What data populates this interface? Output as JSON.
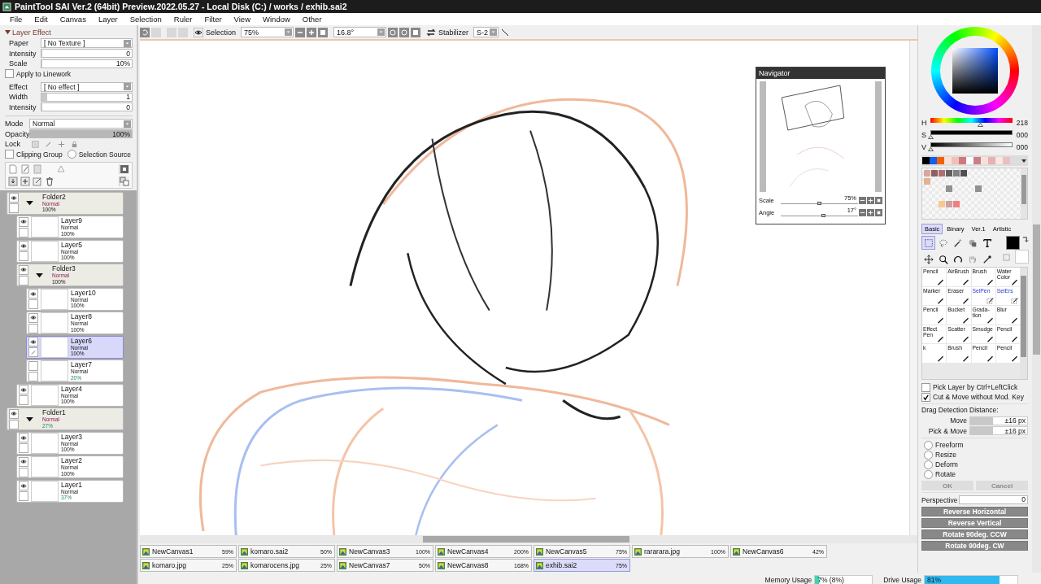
{
  "window": {
    "title": "PaintTool SAI Ver.2 (64bit) Preview.2022.05.27 - Local Disk (C:) / works / exhib.sai2"
  },
  "menu": [
    "File",
    "Edit",
    "Canvas",
    "Layer",
    "Selection",
    "Ruler",
    "Filter",
    "View",
    "Window",
    "Other"
  ],
  "layer_effect": {
    "title": "Layer Effect",
    "expanded": true,
    "paper": {
      "label": "Paper",
      "value": "[ No Texture ]"
    },
    "paper_intensity": {
      "label": "Intensity",
      "value": "0",
      "level": 0
    },
    "scale": {
      "label": "Scale",
      "value": "10%",
      "level": 0.01
    },
    "apply_to_linework": {
      "label": "Apply to Linework",
      "checked": false
    },
    "effect": {
      "label": "Effect",
      "value": "[ No effect ]"
    },
    "width": {
      "label": "Width",
      "value": "1",
      "level": 0.06
    },
    "effect_intensity": {
      "label": "Intensity",
      "value": "0",
      "level": 0
    }
  },
  "layer_props": {
    "mode": {
      "label": "Mode",
      "value": "Normal"
    },
    "opacity": {
      "label": "Opacity",
      "value": "100%",
      "level": 1
    },
    "lock_label": "Lock",
    "clipping_group": {
      "label": "Clipping Group",
      "checked": false
    },
    "selection_source": {
      "label": "Selection Source",
      "checked": false
    }
  },
  "layers": [
    {
      "kind": "folder",
      "name": "Folder2",
      "mode": "Normal",
      "opacity": "100%",
      "changed": false,
      "visible": true,
      "selected": false,
      "expanded": true,
      "children": [
        {
          "kind": "layer",
          "name": "Layer9",
          "mode": "Normal",
          "opacity": "100%",
          "changed": false,
          "visible": true,
          "selected": false
        },
        {
          "kind": "layer",
          "name": "Layer5",
          "mode": "Normal",
          "opacity": "100%",
          "changed": false,
          "visible": true,
          "selected": false
        },
        {
          "kind": "folder",
          "name": "Folder3",
          "mode": "Normal",
          "opacity": "100%",
          "changed": false,
          "visible": true,
          "selected": false,
          "expanded": true,
          "children": [
            {
              "kind": "layer",
              "name": "Layer10",
              "mode": "Normal",
              "opacity": "100%",
              "changed": false,
              "visible": true,
              "selected": false
            },
            {
              "kind": "layer",
              "name": "Layer8",
              "mode": "Normal",
              "opacity": "100%",
              "changed": false,
              "visible": true,
              "selected": false
            },
            {
              "kind": "layer",
              "name": "Layer6",
              "mode": "Normal",
              "opacity": "100%",
              "changed": false,
              "visible": true,
              "selected": true
            },
            {
              "kind": "layer",
              "name": "Layer7",
              "mode": "Normal",
              "opacity": "20%",
              "changed": true,
              "visible": false,
              "selected": false
            }
          ]
        },
        {
          "kind": "layer",
          "name": "Layer4",
          "mode": "Normal",
          "opacity": "100%",
          "changed": false,
          "visible": true,
          "selected": false
        }
      ]
    },
    {
      "kind": "folder",
      "name": "Folder1",
      "mode": "Normal",
      "opacity": "27%",
      "changed": true,
      "visible": true,
      "selected": false,
      "expanded": true,
      "children": [
        {
          "kind": "layer",
          "name": "Layer3",
          "mode": "Normal",
          "opacity": "100%",
          "changed": false,
          "visible": true,
          "selected": false
        },
        {
          "kind": "layer",
          "name": "Layer2",
          "mode": "Normal",
          "opacity": "100%",
          "changed": false,
          "visible": true,
          "selected": false
        },
        {
          "kind": "layer",
          "name": "Layer1",
          "mode": "Normal",
          "opacity": "37%",
          "changed": true,
          "visible": true,
          "selected": false
        }
      ]
    }
  ],
  "toolbar": {
    "selection_label": "Selection",
    "zoom": "75%",
    "angle": "16.8°",
    "stabilizer_label": "Stabilizer",
    "stabilizer": "S-2"
  },
  "navigator": {
    "title": "Navigator",
    "scale": {
      "label": "Scale",
      "value": "75%",
      "level": 0.5
    },
    "angle": {
      "label": "Angle",
      "value": "17°",
      "level": 0.55
    }
  },
  "color": {
    "sliders": [
      {
        "label": "H",
        "value": "218",
        "level": 0.61
      },
      {
        "label": "S",
        "value": "000",
        "level": 0
      },
      {
        "label": "V",
        "value": "000",
        "level": 0
      }
    ],
    "swatches": [
      {
        "color": "#000000"
      },
      {
        "color": "#1060e8"
      },
      {
        "color": "#f06000"
      },
      {
        "color": "#f8e0d8"
      },
      {
        "color": "#f0c0b8"
      },
      {
        "color": "#d07880"
      },
      {
        "color": "#ffffff"
      },
      {
        "color": "#c88088"
      },
      {
        "color": "#f8e0d8"
      },
      {
        "color": "#e8b0b0"
      },
      {
        "color": "#f8e8e0"
      },
      {
        "color": "#e8c0c0"
      }
    ],
    "palette": [
      {
        "cells": [
          {
            "color": "#d8a8a0"
          },
          {
            "color": "#906060"
          },
          {
            "color": "#b07070"
          },
          {
            "color": "#606060"
          },
          {
            "color": "#808080"
          },
          {
            "color": "#505050"
          },
          null,
          null,
          null,
          null,
          null,
          null
        ]
      },
      {
        "cells": [
          {
            "color": "#e8b090"
          },
          null,
          null,
          null,
          null,
          null,
          null,
          null,
          null,
          null,
          null,
          null
        ]
      },
      {
        "cells": [
          null,
          null,
          null,
          {
            "color": "#909090"
          },
          null,
          null,
          null,
          {
            "color": "#909090"
          },
          null,
          null,
          null,
          null
        ]
      },
      {
        "cells": [
          null,
          null,
          null,
          null,
          null,
          null,
          null,
          null,
          null,
          null,
          null,
          null
        ]
      },
      {
        "cells": [
          null,
          null,
          {
            "color": "#f8c890"
          },
          {
            "color": "#d0a0a0"
          },
          {
            "color": "#f08080"
          },
          null,
          null,
          null,
          null,
          null,
          null,
          null
        ]
      },
      {
        "cells": [
          null,
          null,
          null,
          null,
          null,
          null,
          null,
          null,
          null,
          null,
          null,
          null
        ]
      }
    ],
    "current": [
      {
        "color": "#000000"
      },
      {
        "color": "#ffffff"
      }
    ]
  },
  "tool_tabs": [
    {
      "label": "Basic",
      "selected": true
    },
    {
      "label": "Binary",
      "selected": false
    },
    {
      "label": "Ver.1",
      "selected": false
    },
    {
      "label": "Artistic",
      "selected": false
    }
  ],
  "tools": [
    {
      "kind": "select",
      "selected": true
    },
    {
      "kind": "lasso",
      "selected": false
    },
    {
      "kind": "wand",
      "selected": false
    },
    {
      "kind": "shape",
      "selected": false
    },
    {
      "kind": "text",
      "selected": false
    },
    {
      "kind": "move",
      "selected": false
    },
    {
      "kind": "zoom",
      "selected": false
    },
    {
      "kind": "rotate",
      "selected": false
    },
    {
      "kind": "hand",
      "selected": false
    },
    {
      "kind": "picker",
      "selected": false
    }
  ],
  "brushes": [
    {
      "label": "Pencil",
      "kind": "paint"
    },
    {
      "label": "AirBrush",
      "kind": "paint"
    },
    {
      "label": "Brush",
      "kind": "paint"
    },
    {
      "label": "Water Color",
      "kind": "paint"
    },
    {
      "label": "Marker",
      "kind": "paint"
    },
    {
      "label": "Eraser",
      "kind": "paint"
    },
    {
      "label": "SelPen",
      "kind": "selection"
    },
    {
      "label": "SelErs",
      "kind": "selection"
    },
    {
      "label": "Pencil",
      "kind": "paint"
    },
    {
      "label": "Bucket",
      "kind": "paint"
    },
    {
      "label": "Grada-tion",
      "kind": "paint"
    },
    {
      "label": "Blur",
      "kind": "paint"
    },
    {
      "label": "Effect Pen",
      "kind": "paint"
    },
    {
      "label": "Scatter",
      "kind": "paint"
    },
    {
      "label": "Smudge",
      "kind": "paint"
    },
    {
      "label": "Pencil",
      "kind": "paint"
    },
    {
      "label": "k",
      "kind": "paint"
    },
    {
      "label": "Brush",
      "kind": "paint"
    },
    {
      "label": "Pencil",
      "kind": "paint"
    },
    {
      "label": "Pencil",
      "kind": "paint"
    }
  ],
  "options": {
    "checks": [
      {
        "label": "Pick Layer by Ctrl+LeftClick",
        "checked": false
      },
      {
        "label": "Cut & Move without Mod. Key",
        "checked": true
      }
    ],
    "drag_title": "Drag Detection Distance:",
    "drag": [
      {
        "label": "Move",
        "value": "±16 px",
        "level": 0.4
      },
      {
        "label": "Pick & Move",
        "value": "±16 px",
        "level": 0.4
      }
    ],
    "modes": [
      {
        "label": "Freeform",
        "selected": false
      },
      {
        "label": "Resize",
        "selected": false
      },
      {
        "label": "Deform",
        "selected": false
      },
      {
        "label": "Rotate",
        "selected": false
      }
    ],
    "ok": "OK",
    "cancel": "Cancel",
    "confirm_disabled": true,
    "perspective": {
      "label": "Perspective",
      "value": "0"
    },
    "actions": [
      "Reverse Horizontal",
      "Reverse Vertical",
      "Rotate 90deg. CCW",
      "Rotate 90deg. CW"
    ]
  },
  "canvas_tabs": [
    {
      "name": "NewCanvas1",
      "zoom": "59%",
      "selected": false
    },
    {
      "name": "komaro.sai2",
      "zoom": "50%",
      "selected": false
    },
    {
      "name": "NewCanvas3",
      "zoom": "100%",
      "selected": false
    },
    {
      "name": "NewCanvas4",
      "zoom": "200%",
      "selected": false
    },
    {
      "name": "NewCanvas5",
      "zoom": "75%",
      "selected": false
    },
    {
      "name": "rararara.jpg",
      "zoom": "100%",
      "selected": false
    },
    {
      "name": "NewCanvas6",
      "zoom": "42%",
      "selected": false
    },
    {
      "name": "komaro.jpg",
      "zoom": "25%",
      "selected": false
    },
    {
      "name": "komarocens.jpg",
      "zoom": "25%",
      "selected": false
    },
    {
      "name": "NewCanvas7",
      "zoom": "50%",
      "selected": false
    },
    {
      "name": "NewCanvas8",
      "zoom": "168%",
      "selected": false
    },
    {
      "name": "exhib.sai2",
      "zoom": "75%",
      "selected": true
    }
  ],
  "status": {
    "memory": {
      "label": "Memory Usage",
      "value": "7% (8%)",
      "level": 0.07
    },
    "drive": {
      "label": "Drive Usage",
      "value": "81%",
      "level": 0.81
    }
  }
}
